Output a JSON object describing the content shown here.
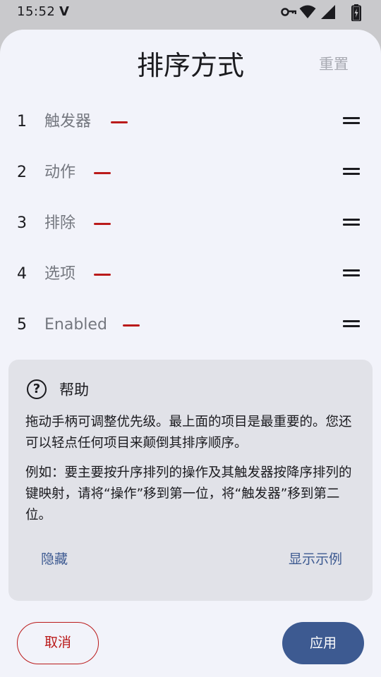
{
  "status_bar": {
    "time": "15:52",
    "left_icon": "V",
    "icons": [
      "key-icon",
      "wifi-icon",
      "signal-icon",
      "battery-charging-icon"
    ]
  },
  "sheet": {
    "title": "排序方式",
    "reset_label": "重置"
  },
  "sort_items": [
    {
      "number": "1",
      "label": "触发器"
    },
    {
      "number": "2",
      "label": "动作"
    },
    {
      "number": "3",
      "label": "排除"
    },
    {
      "number": "4",
      "label": "选项"
    },
    {
      "number": "5",
      "label": "Enabled"
    }
  ],
  "help": {
    "icon": "help-circle-icon",
    "title": "帮助",
    "paragraph1": "拖动手柄可调整优先级。最上面的项目是最重要的。您还可以轻点任何项目来颠倒其排序顺序。",
    "paragraph2": "例如：要主要按升序排列的操作及其触发器按降序排列的键映射，请将“操作”移到第一位，将“触发器”移到第二位。",
    "hide_label": "隐藏",
    "show_example_label": "显示示例"
  },
  "actions": {
    "cancel_label": "取消",
    "apply_label": "应用"
  },
  "colors": {
    "accent": "#3d5a91",
    "error": "#ba1a1a",
    "surface": "#f2f3fa",
    "card": "#e1e2e8"
  }
}
